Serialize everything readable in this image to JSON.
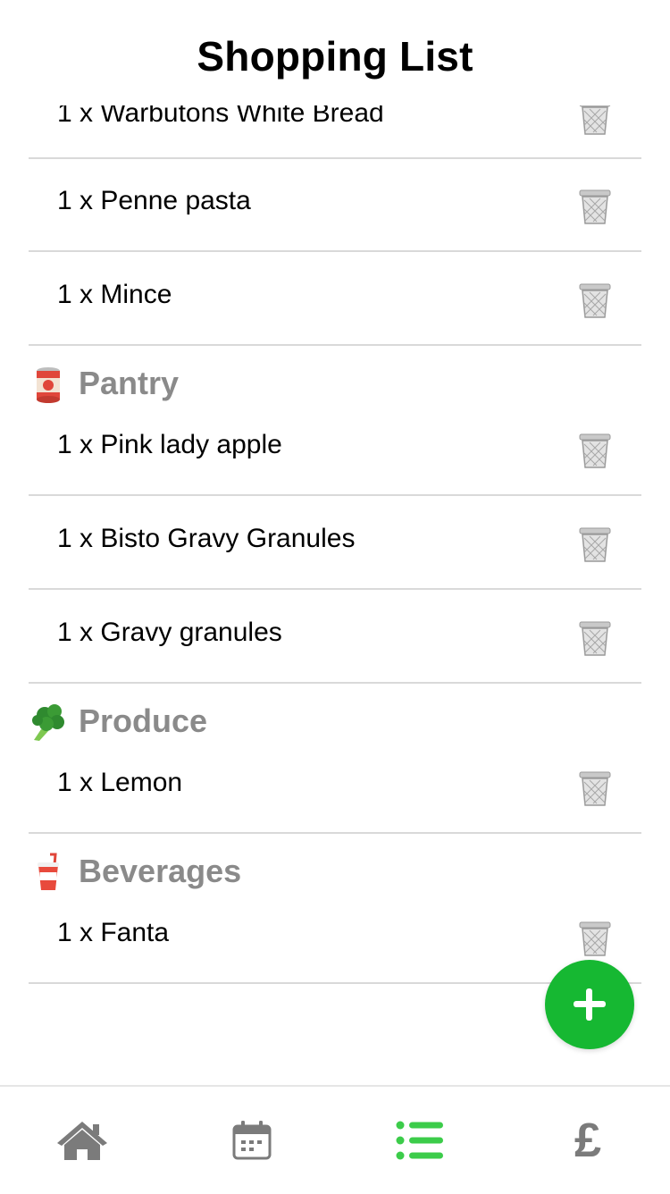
{
  "header": {
    "title": "Shopping List"
  },
  "partial_item": {
    "label": "1 x Warbutons White Bread"
  },
  "groups": [
    {
      "items": [
        "1 x Penne pasta",
        "1 x Mince"
      ]
    },
    {
      "section": "Pantry",
      "icon": "canned-food-icon",
      "items": [
        "1 x Pink lady apple",
        "1 x Bisto Gravy Granules",
        "1 x Gravy granules"
      ]
    },
    {
      "section": "Produce",
      "icon": "broccoli-icon",
      "items": [
        "1 x Lemon"
      ]
    },
    {
      "section": "Beverages",
      "icon": "cup-with-straw-icon",
      "items": [
        "1 x Fanta"
      ]
    }
  ],
  "fab": {
    "icon": "plus-icon",
    "color": "#16b832"
  },
  "tabbar": {
    "tabs": [
      {
        "icon": "home-icon",
        "active": false
      },
      {
        "icon": "calendar-icon",
        "active": false
      },
      {
        "icon": "list-icon",
        "active": true
      },
      {
        "icon": "pound-sign-icon",
        "label": "£",
        "active": false
      }
    ],
    "active_color": "#3ccc4a",
    "inactive_color": "#7b7b7b"
  }
}
